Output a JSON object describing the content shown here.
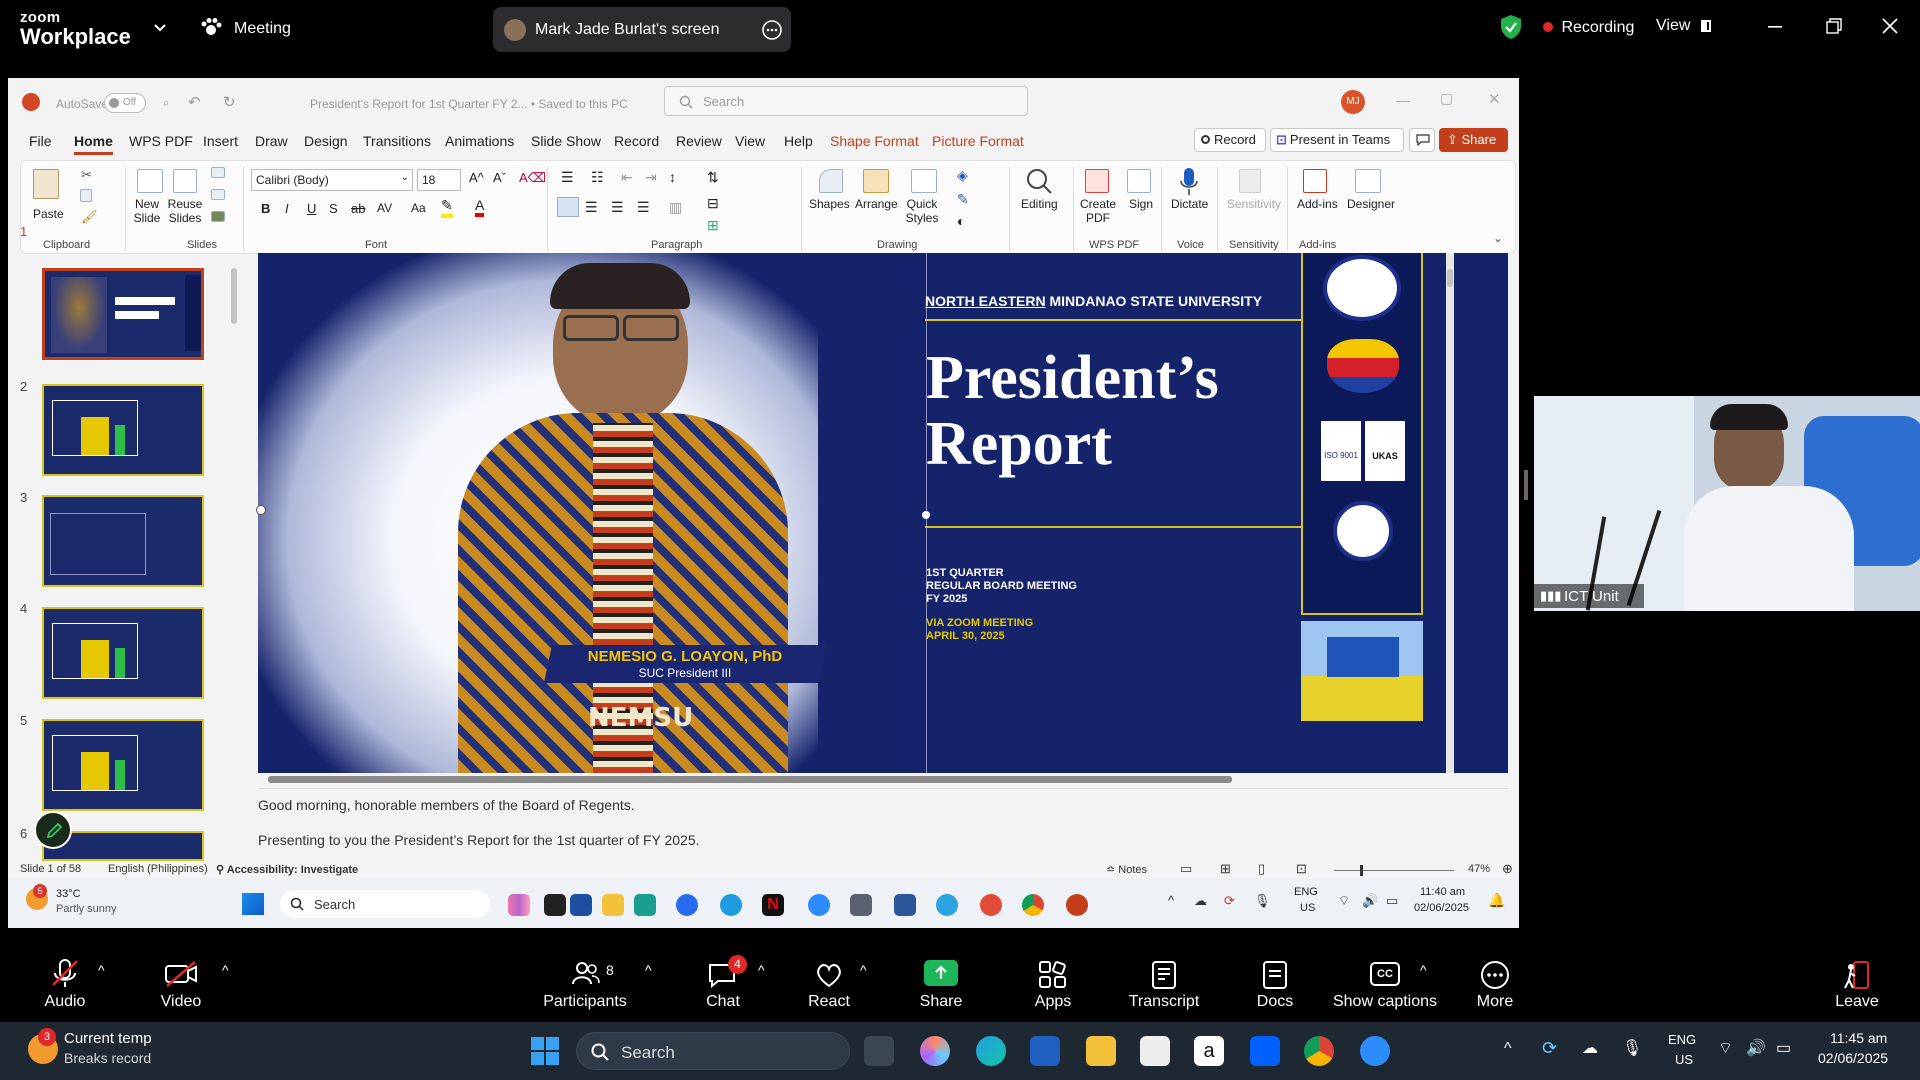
{
  "zoom": {
    "brand_top": "zoom",
    "brand_bottom": "Workplace",
    "meeting_label": "Meeting",
    "share_title": "Mark Jade Burlat's screen",
    "recording_label": "Recording",
    "view_label": "View",
    "camera_name": "ICT Unit",
    "controls": {
      "audio": "Audio",
      "video": "Video",
      "participants": "Participants",
      "participants_count": "8",
      "chat": "Chat",
      "chat_badge": "4",
      "react": "React",
      "share": "Share",
      "apps": "Apps",
      "transcript": "Transcript",
      "docs": "Docs",
      "captions": "Show captions",
      "more": "More",
      "leave": "Leave"
    }
  },
  "ppt": {
    "autosave": "AutoSave",
    "autosave_state": "Off",
    "doc_title": "President's Report for 1st Quarter FY 2... • Saved to this PC",
    "search_placeholder": "Search",
    "user_initials": "MJ",
    "menu": [
      "File",
      "Home",
      "WPS PDF",
      "Insert",
      "Draw",
      "Design",
      "Transitions",
      "Animations",
      "Slide Show",
      "Record",
      "Review",
      "View",
      "Help",
      "Shape Format",
      "Picture Format"
    ],
    "record_btn": "Record",
    "present_btn": "Present in Teams",
    "share_btn": "Share",
    "ribbon": {
      "paste": "Paste",
      "new_slide": "New Slide",
      "reuse_slides": "Reuse Slides",
      "font_name": "Calibri (Body)",
      "font_size": "18",
      "shapes": "Shapes",
      "arrange": "Arrange",
      "quick_styles": "Quick Styles",
      "editing": "Editing",
      "create_pdf": "Create PDF",
      "sign": "Sign",
      "dictate": "Dictate",
      "sensitivity": "Sensitivity",
      "addins": "Add-ins",
      "designer": "Designer",
      "groups": {
        "clipboard": "Clipboard",
        "slides": "Slides",
        "font": "Font",
        "paragraph": "Paragraph",
        "drawing": "Drawing",
        "wpspdf": "WPS PDF",
        "voice": "Voice",
        "sensitivity": "Sensitivity",
        "addins": "Add-ins"
      }
    },
    "thumb_numbers": [
      "1",
      "2",
      "3",
      "4",
      "5",
      "6"
    ],
    "slide": {
      "university_underlined": "NORTH EASTERN",
      "university_rest": " MINDANAO STATE UNIVERSITY",
      "title_line1": "President’s",
      "title_line2": "Report",
      "meeting_line1": "1ST QUARTER",
      "meeting_line2": "REGULAR BOARD MEETING",
      "meeting_line3": "FY 2025",
      "via_line1": "VIA ZOOM MEETING",
      "via_line2": "APRIL 30, 2025",
      "name": "NEMESIO G. LOAYON, PhD",
      "position": "SUC President III",
      "iso_text": "ISO 9001",
      "ukas_text": "UKAS",
      "nemsu_text": "NEMSU"
    },
    "notes_line1": "Good morning, honorable members of the Board of Regents.",
    "notes_line2": "Presenting to you the President’s Report for the 1st quarter of FY 2025.",
    "status": {
      "slide_of": "Slide 1 of 58",
      "language": "English (Philippines)",
      "accessibility": "Accessibility: Investigate",
      "notes": "Notes",
      "zoom_pct": "47%"
    },
    "taskbar": {
      "temp": "33°C",
      "weather": "Partly sunny",
      "weather_badge": "5",
      "search": "Search",
      "lang1": "ENG",
      "lang2": "US",
      "time": "11:40 am",
      "date": "02/06/2025"
    }
  },
  "windows": {
    "weather_title": "Current temp",
    "weather_sub": "Breaks record",
    "weather_badge": "3",
    "search": "Search",
    "lang1": "ENG",
    "lang2": "US",
    "time": "11:45 am",
    "date": "02/06/2025"
  }
}
